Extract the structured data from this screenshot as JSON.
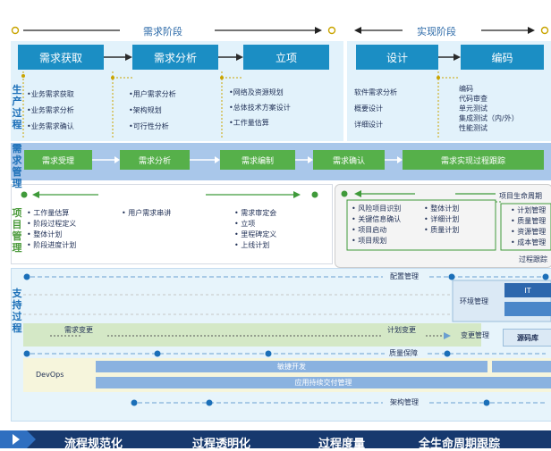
{
  "phases": {
    "requirement": "需求阶段",
    "implementation": "实现阶段"
  },
  "production": {
    "label": "生产过程",
    "steps": [
      "需求获取",
      "需求分析",
      "立项",
      "设计",
      "编码"
    ],
    "items": [
      [
        "•业务需求获取",
        "•业务需求分析",
        "•业务需求确认"
      ],
      [
        "•用户需求分析",
        "•架构规划",
        "•可行性分析"
      ],
      [
        "•网络及资源规划",
        "•总体技术方案设计",
        "•工作量估算"
      ],
      [
        "软件需求分析",
        "概要设计",
        "详细设计"
      ],
      [
        "编码",
        "代码审查",
        "单元测试",
        "集成测试（内/外）",
        "性能测试"
      ]
    ]
  },
  "requirement_mgmt": {
    "label": "需求管理",
    "steps": [
      "需求受理",
      "需求分析",
      "需求编制",
      "需求确认",
      "需求实现过程跟踪"
    ]
  },
  "project_mgmt": {
    "label": "项目管理",
    "col1": [
      "• 工作量估算",
      "• 阶段过程定义",
      "• 整体计划",
      "• 阶段进度计划"
    ],
    "col2": [
      "• 用户需求串讲"
    ],
    "col3": [
      "• 需求审定会",
      "• 立项",
      "• 里程碑定义",
      "• 上线计划"
    ],
    "right_a": [
      "• 风险项目识别",
      "• 关键信息确认",
      "• 项目启动",
      "• 项目规划"
    ],
    "right_b": [
      "• 整体计划",
      "• 详细计划",
      "• 质量计划"
    ],
    "lifecycle_title": "项目生命周期",
    "lifecycle_items": [
      "• 计划管理",
      "• 质量管理",
      "• 资源管理",
      "• 成本管理"
    ],
    "tracking": "过程跟踪"
  },
  "support": {
    "label": "支持过程",
    "config_mgmt": "配置管理",
    "env_mgmt": "环境管理",
    "it": "IT",
    "req_change": "需求变更",
    "plan_change": "计划变更",
    "change_mgmt": "变更管理",
    "code_repo": "源码库",
    "qa": "质量保障",
    "devops": "DevOps",
    "agile": "敏捷开发",
    "cd": "应用持续交付管理",
    "arch_mgmt": "架构管理"
  },
  "bottom": [
    "流程规范化",
    "过程透明化",
    "过程度量",
    "全生命周期跟踪"
  ],
  "colors": {
    "blue": "#1b8ec4",
    "green": "#56b04a",
    "band_blue": "#a9c7ea",
    "dark_navy": "#17396e"
  }
}
